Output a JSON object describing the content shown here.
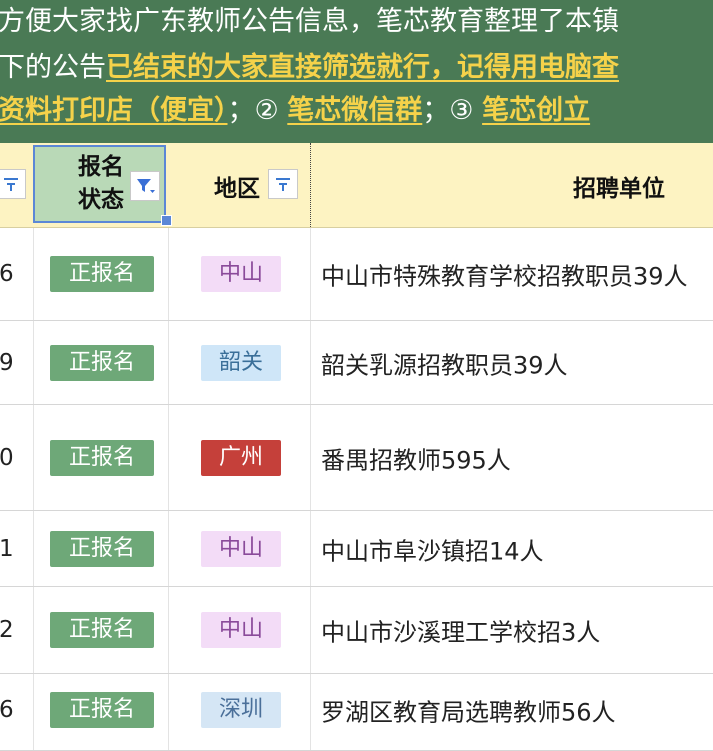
{
  "banner": {
    "line1": "方便大家找广东教师公告信息，笔芯教育整理了本镇",
    "line2_prefix": "下的公告",
    "line2_highlight": "已结束的大家直接筛选就行，记得用电脑查",
    "line3_item1": "资料打印店（便宜）",
    "line3_sep1": "；② ",
    "line3_item2": "笔芯微信群",
    "line3_sep2": "；③ ",
    "line3_item3": "笔芯创立"
  },
  "header": {
    "status_label_line1": "报名",
    "status_label_line2": "状态",
    "region_label": "地区",
    "unit_label": "招聘单位"
  },
  "rows": [
    {
      "idx": "6",
      "status": "正报名",
      "region": "中山",
      "unit": "中山市特殊教育学校招教职员39人"
    },
    {
      "idx": "9",
      "status": "正报名",
      "region": "韶关",
      "unit": "韶关乳源招教职员39人"
    },
    {
      "idx": "0",
      "status": "正报名",
      "region": "广州",
      "unit": "番禺招教师595人"
    },
    {
      "idx": "1",
      "status": "正报名",
      "region": "中山",
      "unit": "中山市阜沙镇招14人"
    },
    {
      "idx": "2",
      "status": "正报名",
      "region": "中山",
      "unit": "中山市沙溪理工学校招3人"
    },
    {
      "idx": "6",
      "status": "正报名",
      "region": "深圳",
      "unit": "罗湖区教育局选聘教师56人"
    }
  ],
  "colors": {
    "banner_bg": "#4a7a55",
    "highlight": "#f5d24a",
    "header_bg": "#fdf3c2",
    "status_tag": "#6ea878",
    "region_zhongshan_bg": "#f3dcf7",
    "region_zhongshan_fg": "#8a4a9a",
    "region_shaoguan_bg": "#cfe6f8",
    "region_shaoguan_fg": "#3a6f99",
    "region_guangzhou_bg": "#c5403a",
    "region_guangzhou_fg": "#ffffff",
    "region_shenzhen_bg": "#d5e6f5",
    "region_shenzhen_fg": "#4a6f99"
  },
  "icons": {
    "filter": "filter-icon",
    "filter_active": "filter-active-icon"
  }
}
